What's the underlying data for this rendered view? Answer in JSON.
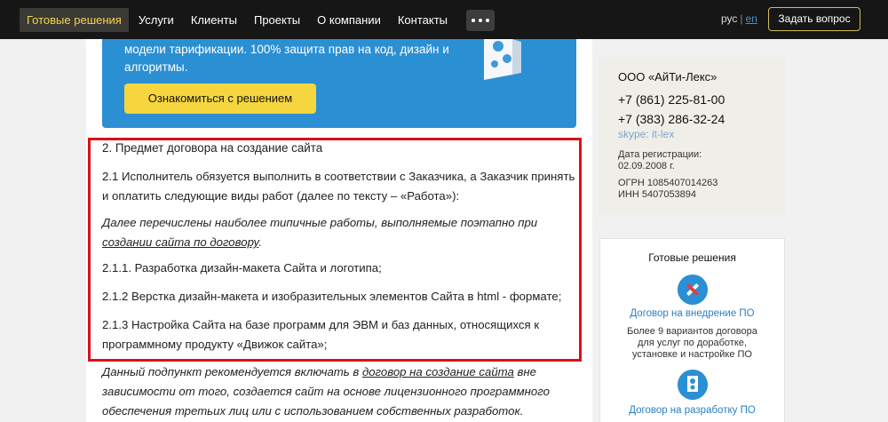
{
  "nav": {
    "items": [
      {
        "label": "Готовые решения",
        "active": true
      },
      {
        "label": "Услуги",
        "active": false
      },
      {
        "label": "Клиенты",
        "active": false
      },
      {
        "label": "Проекты",
        "active": false
      },
      {
        "label": "О компании",
        "active": false
      },
      {
        "label": "Контакты",
        "active": false
      }
    ],
    "more_icon": "more-dots-icon",
    "lang_ru": "рус",
    "lang_sep": "|",
    "lang_en": "en",
    "ask_button": "Задать вопрос"
  },
  "promo": {
    "text": "модели тарификации. 100% защита прав на код, дизайн и алгоритмы.",
    "button": "Ознакомиться с решением",
    "icon": "software-box-icon"
  },
  "article": {
    "heading": "2. Предмет договора на создание сайта",
    "p1": "2.1 Исполнитель обязуется выполнить в соответствии с Заказчика, а Заказчик принять и оплатить следующие виды работ (далее по тексту – «Работа»):",
    "note1_text": "Далее перечислены наиболее типичные работы, выполняемые поэтапно при ",
    "note1_link": "создании сайта по договору",
    "note1_end": ".",
    "i1": "2.1.1. Разработка дизайн-макета Сайта и логотипа;",
    "i2": "2.1.2 Верстка дизайн-макета и изобразительных элементов Сайта в html - формате;",
    "i3": "2.1.3 Настройка Сайта на базе программ для ЭВМ и баз данных, относящихся к программному продукту «Движок сайта»;",
    "note2_text": "Данный подпункт рекомендуется включать в ",
    "note2_link": "договор на создание сайта",
    "note2_end": " вне зависимости от того, создается сайт на основе лицензионного программного обеспечения третьих лиц или с использованием собственных разработок."
  },
  "company": {
    "name": "ООО «АйТи-Лекс»",
    "phone1": "+7 (861) 225-81-00",
    "phone2": "+7 (383) 286-32-24",
    "skype": "skype: it-lex",
    "reg_label": "Дата регистрации:",
    "reg_date": "02.09.2008 г.",
    "ogrn": "ОГРН 1085407014263",
    "inn": "ИНН 5407053894"
  },
  "solutions": {
    "title": "Готовые решения",
    "items": [
      {
        "icon": "tools-icon",
        "link": "Договор на внедрение ПО",
        "desc1": "Более 9 вариантов договора",
        "desc2": "для услуг по доработке,",
        "desc3": "установке и настройке ПО"
      },
      {
        "icon": "software-doc-icon",
        "link": "Договор на разработку ПО"
      }
    ]
  },
  "colors": {
    "nav_bg": "#161616",
    "active_text": "#f3d54a",
    "promo_bg": "#2b8fd3",
    "promo_button": "#f6d63e",
    "highlight": "#d9101a",
    "link": "#2b7fc4"
  }
}
